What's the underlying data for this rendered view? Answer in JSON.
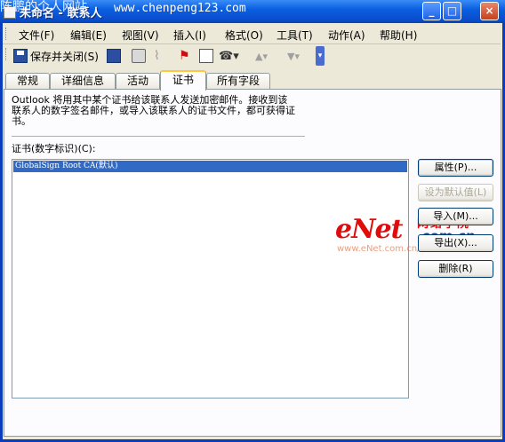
{
  "window": {
    "watermark": "陈鹏的个人网站",
    "title": "未命名 - 联系人",
    "url": "www.chenpeng123.com",
    "controls": {
      "minimize": "_",
      "maximize": "□",
      "close": "×"
    }
  },
  "menu": [
    "文件(F)",
    "编辑(E)",
    "视图(V)",
    "插入(I)",
    "格式(O)",
    "工具(T)",
    "动作(A)",
    "帮助(H)"
  ],
  "toolbar": {
    "save_close": "保存并关闭(S)",
    "icons": [
      "save-icon",
      "print-icon",
      "attach-icon",
      "flag-icon",
      "contact-card-icon",
      "phone-icon",
      "up-arrow-icon",
      "down-arrow-icon"
    ]
  },
  "tabs": [
    "常规",
    "详细信息",
    "活动",
    "证书",
    "所有字段"
  ],
  "active_tab": "证书",
  "panel": {
    "description": "Outlook 将用其中某个证书给该联系人发送加密邮件。接收到该联系人的数字签名邮件，或导入该联系人的证书文件，都可获得证书。",
    "list_label": "证书(数字标识)(C):",
    "certificates": [
      "GlobalSign Root CA(默认)"
    ]
  },
  "buttons": {
    "properties": "属性(P)...",
    "set_default": "设为默认值(L)",
    "import": "导入(M)...",
    "export": "导出(X)...",
    "delete": "删除(R)"
  },
  "logo": {
    "brand": "eNet",
    "cn": "网络学院",
    "domain": ".com.cn",
    "url": "www.eNet.com.cn/eschool"
  },
  "colors": {
    "titlebar": "#0a4fd0",
    "selection": "#316ac5",
    "tab_highlight": "#ffc83c",
    "logo_red": "#e00c0c",
    "logo_blue": "#1c3ec7"
  }
}
